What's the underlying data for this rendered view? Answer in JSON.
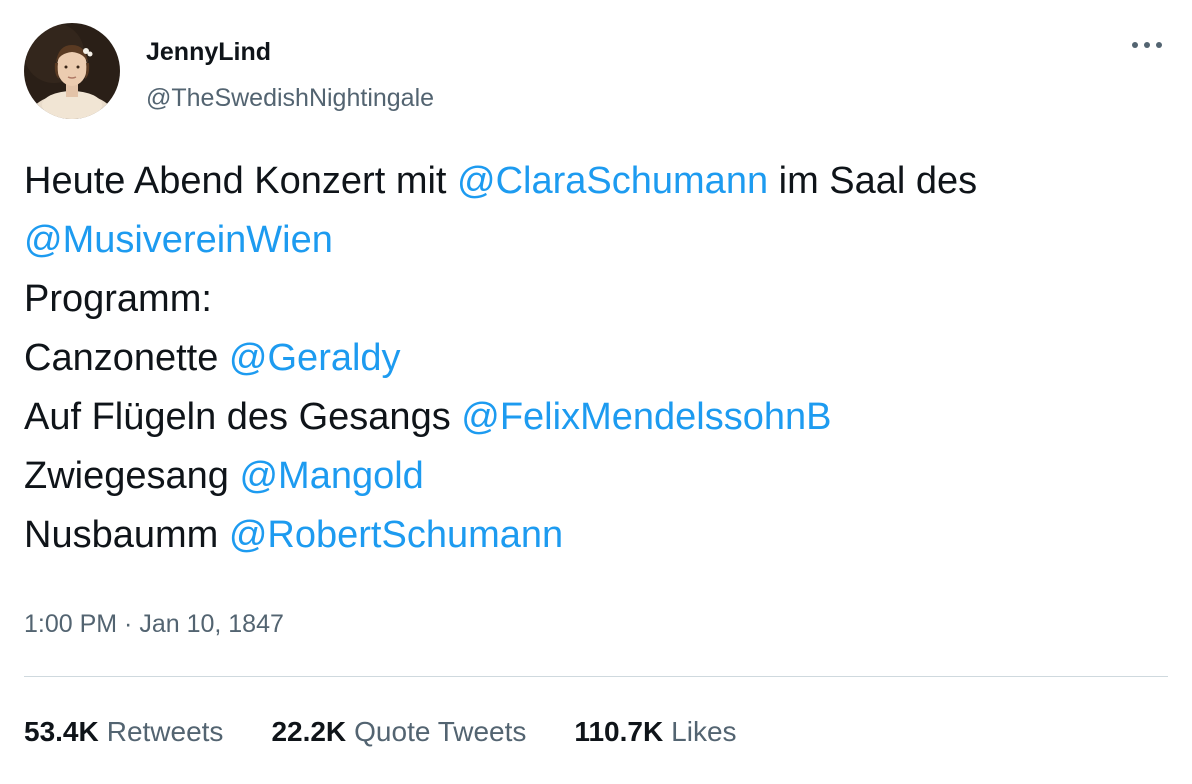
{
  "author": {
    "display_name": "JennyLind",
    "handle": "@TheSwedishNightingale",
    "avatar_icon": "portrait-avatar"
  },
  "more_icon": "more-horizontal-icon",
  "tweet": {
    "line1_text": "Heute Abend Konzert mit ",
    "line1_mention": "@ClaraSchumann",
    "line1_tail": " im Saal des",
    "line2_mention": "@MusivereinWien",
    "line3_text": "Programm:",
    "line4_text": "Canzonette ",
    "line4_mention": "@Geraldy",
    "line5_text": "Auf Flügeln des Gesangs ",
    "line5_mention": "@FelixMendelssohnB",
    "line6_text": "Zwiegesang ",
    "line6_mention": "@Mangold",
    "line7_text": "Nusbaumm ",
    "line7_mention": "@RobertSchumann"
  },
  "meta": {
    "time": "1:00 PM",
    "separator": " · ",
    "date": "Jan 10, 1847"
  },
  "stats": {
    "retweets_count": "53.4K",
    "retweets_label": "Retweets",
    "quotes_count": "22.2K",
    "quotes_label": "Quote Tweets",
    "likes_count": "110.7K",
    "likes_label": "Likes"
  },
  "colors": {
    "text": "#0f1419",
    "secondary": "#536471",
    "link": "#1d9bf0",
    "divider": "#cfd9de"
  }
}
